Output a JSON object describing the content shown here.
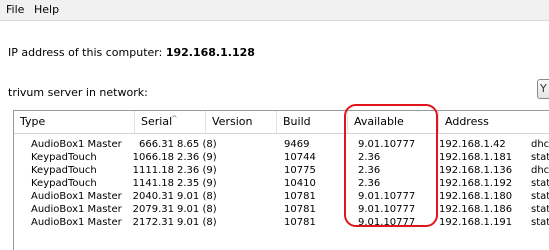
{
  "menu": {
    "file": "File",
    "help": "Help"
  },
  "ip": {
    "label": "IP address of this computer:",
    "value": "192.168.1.128"
  },
  "servers_label": "trivum server in network:",
  "table": {
    "columns": [
      "Type",
      "Serial",
      "Version",
      "Build",
      "Available",
      "Address"
    ],
    "rows": [
      [
        "AudioBox1 Master",
        "666.31",
        "8.65 (8)",
        "9469",
        "9.01.10777",
        "192.168.1.42",
        "dhc"
      ],
      [
        "KeypadTouch",
        "1066.18",
        "2.36 (9)",
        "10744",
        "2.36",
        "192.168.1.181",
        "stat"
      ],
      [
        "KeypadTouch",
        "1111.18",
        "2.36 (9)",
        "10775",
        "2.36",
        "192.168.1.136",
        "dhc"
      ],
      [
        "KeypadTouch",
        "1141.18",
        "2.35 (9)",
        "10410",
        "2.36",
        "192.168.1.192",
        "stat"
      ],
      [
        "AudioBox1 Master",
        "2040.31",
        "9.01 (8)",
        "10781",
        "9.01.10777",
        "192.168.1.180",
        "stat"
      ],
      [
        "AudioBox1 Master",
        "2079.31",
        "9.01 (8)",
        "10781",
        "9.01.10777",
        "192.168.1.186",
        "stat"
      ],
      [
        "AudioBox1 Master",
        "2172.31",
        "9.01 (8)",
        "10781",
        "9.01.10777",
        "192.168.1.191",
        "stat"
      ]
    ]
  },
  "colors": {
    "highlight": "#e0141b"
  }
}
